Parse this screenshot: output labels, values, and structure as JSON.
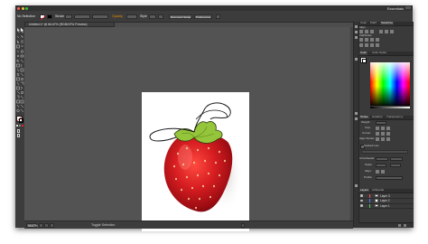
{
  "app": {
    "workspace": "Essentials"
  },
  "control_bar": {
    "selection_label": "No Selection",
    "stroke_label": "Stroke",
    "opacity_label": "Opacity",
    "style_label": "Style",
    "document_setup": "Document Setup",
    "preferences": "Preferences"
  },
  "document_tab": {
    "title": "Untitled-1* @ 66.67% (RGB/GPU Preview)"
  },
  "status_bar": {
    "zoom": "66.67%",
    "mode": "Toggle Selection"
  },
  "panels": {
    "top_tabs": [
      "Color",
      "Pathf",
      "Swatches"
    ],
    "top_active": 2,
    "tab_label_a": "Align",
    "tab_label_b": "Pathfinder",
    "color_tab": "Color",
    "color_guide_tab": "Color Guide",
    "stroke_tabs": [
      "Stroke",
      "Gradient",
      "Transparency"
    ],
    "stroke_rows": [
      "Weight:",
      "Cap:",
      "Corner:",
      "Align Stroke:",
      "Dashed Line",
      "Arrowheads:",
      "Scale:",
      "Align:",
      "Profile:"
    ],
    "layers_tabs": [
      "Layers",
      "Artboards"
    ],
    "layers": [
      "Layer 3",
      "Layer 2",
      "Layer 1"
    ],
    "layer_colors": [
      "#ff4f4f",
      "#4f7dff",
      "#4fd15f"
    ]
  },
  "colors": {
    "ui_dark": "#3c3c3c",
    "canvas": "#535353",
    "artboard": "#ffffff",
    "accent_orange": "#e38b00",
    "strawberry_red": "#c8141b",
    "leaf_green": "#94c53a"
  }
}
